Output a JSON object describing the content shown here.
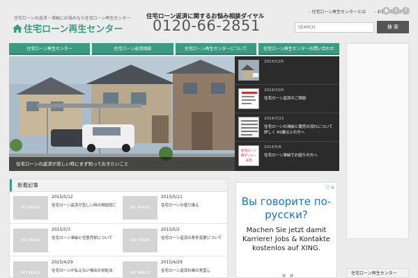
{
  "header": {
    "tagline": "住宅ローンの返済・滞納にお悩みなら住宅ローン再生センター",
    "logo_text": "住宅ローン再生センター",
    "phone_caption": "住宅ローン返済に関するお悩み相談ダイヤル",
    "phone_number": "0120-66-2851",
    "top_links": [
      "住宅ローン再生センターとは",
      "お問い合わせ"
    ],
    "search_placeholder": "SEARCH",
    "search_button": "検 索"
  },
  "nav": {
    "tabs": [
      "住宅ローン再生センター",
      "住宅ローン返済相談",
      "住宅ローン再生センターについて",
      "住宅ローン再生センターお問い合わせ"
    ]
  },
  "hero": {
    "caption": "住宅ローンの返済が苦しい時にまず知っておきたいこと"
  },
  "slider": {
    "items": [
      {
        "date": "2014/12/5",
        "title": ""
      },
      {
        "date": "2014/10/9",
        "title": "住宅ローン返済のご相談"
      },
      {
        "date": "2014/7/23",
        "title": "住宅ローンの滞納と競売の流れについて詳しく 65歳以上の方へ"
      },
      {
        "date": "2014/5/6",
        "title": "住宅ローン滞納でお困りの方へ"
      }
    ],
    "thumb4_text": "住宅ローン 親子リレー返済"
  },
  "new_posts": {
    "heading": "新着記事",
    "noimage": "NO IMAGE",
    "posts": [
      {
        "date": "2015/5/12",
        "title": "住宅ローン返済が苦しい時の相談窓口"
      },
      {
        "date": "2015/5/11",
        "title": "住宅ローンの借り換え"
      },
      {
        "date": "2015/5/3",
        "title": "住宅ローン滞納と任意売却について"
      },
      {
        "date": "2015/5/2",
        "title": "住宅ローン返済の条件変更について"
      },
      {
        "date": "2015/4/29",
        "title": "住宅ローンが払えない場合の対処法"
      },
      {
        "date": "2015/4/29",
        "title": "住宅ローン返済計画の見直し"
      }
    ]
  },
  "ad": {
    "close": "ⓘ ✕",
    "headline": "Вы говорите по-русски?",
    "body": "Machen Sie jetzt damit Karriere! Jobs & Kontakte kostenlos auf XING."
  },
  "sidebar": {
    "heading": "住宅ローン再生センター"
  },
  "colors": {
    "accent": "#3a9b82",
    "dark": "#2b2b2b"
  }
}
